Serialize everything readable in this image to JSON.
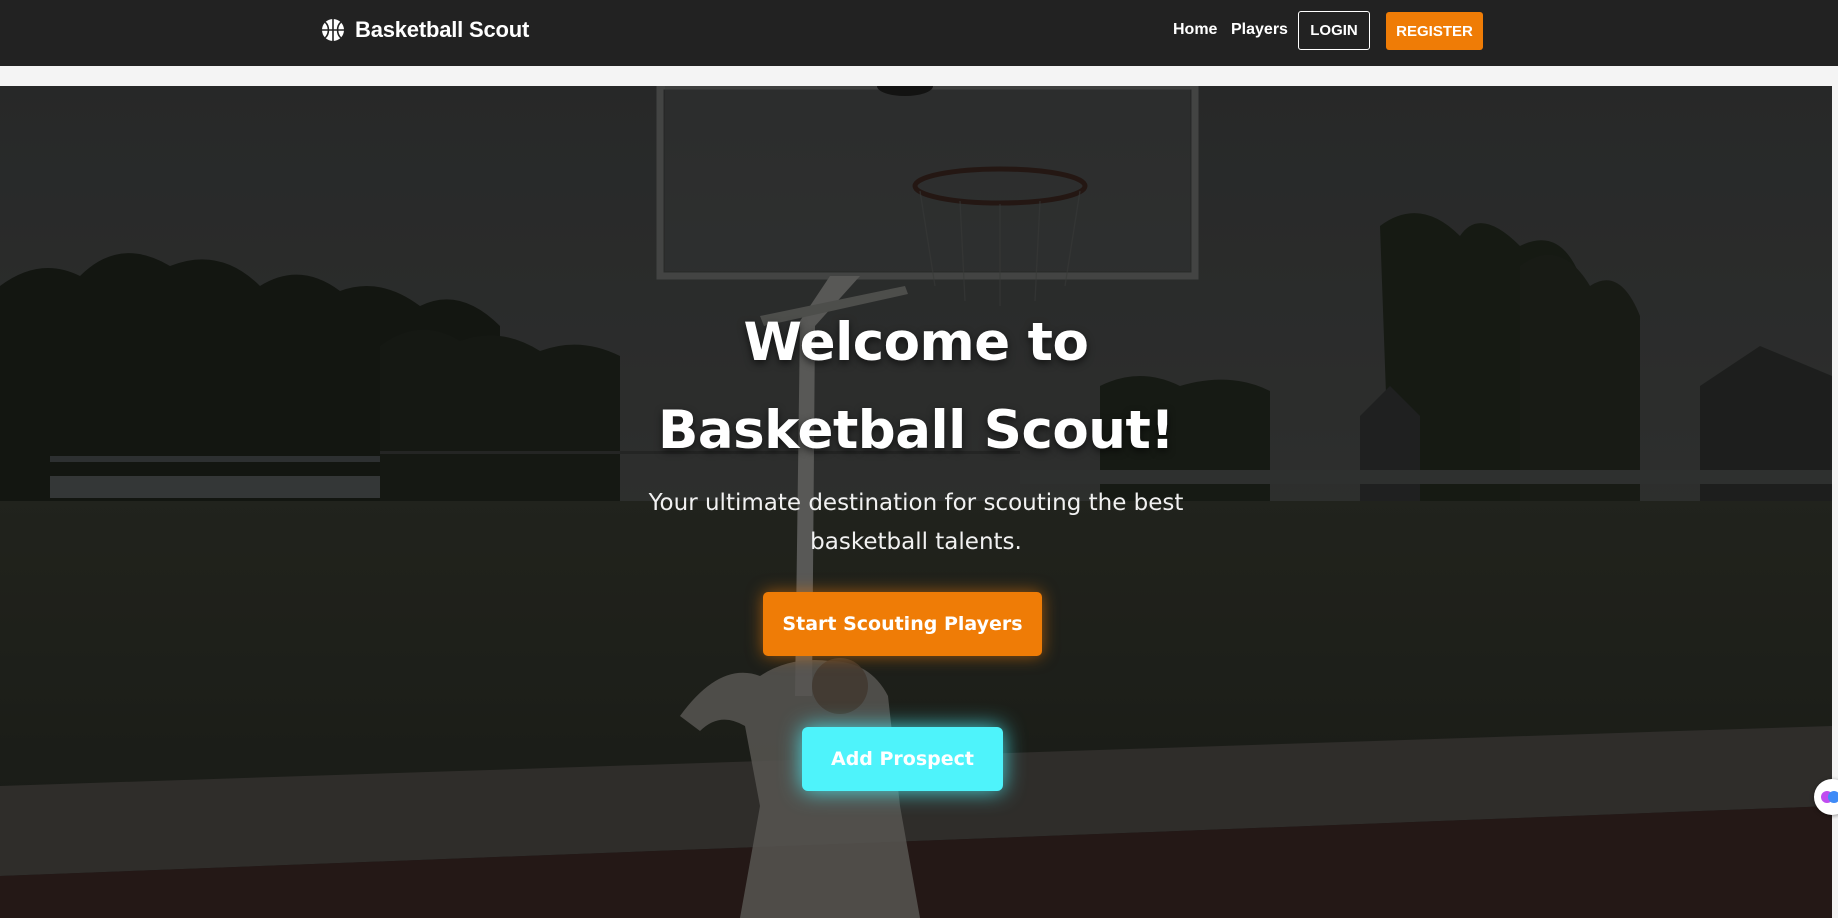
{
  "navbar": {
    "brand_name": "Basketball Scout",
    "brand_icon": "basketball-icon",
    "links": {
      "home": "Home",
      "players": "Players"
    },
    "login_label": "LOGIN",
    "register_label": "REGISTER"
  },
  "hero": {
    "title_line1": "Welcome to",
    "title_line2": "Basketball Scout!",
    "subtitle_line1": "Your ultimate destination for scouting the best",
    "subtitle_line2": "basketball talents.",
    "primary_cta": "Start Scouting Players",
    "secondary_cta": "Add Prospect",
    "background_image": "outdoor-basketball-court-photo"
  },
  "colors": {
    "navbar_bg": "#222222",
    "accent_orange": "#ef7c06",
    "accent_cyan": "#4ef3fb",
    "page_bg": "#f4f4f4"
  }
}
